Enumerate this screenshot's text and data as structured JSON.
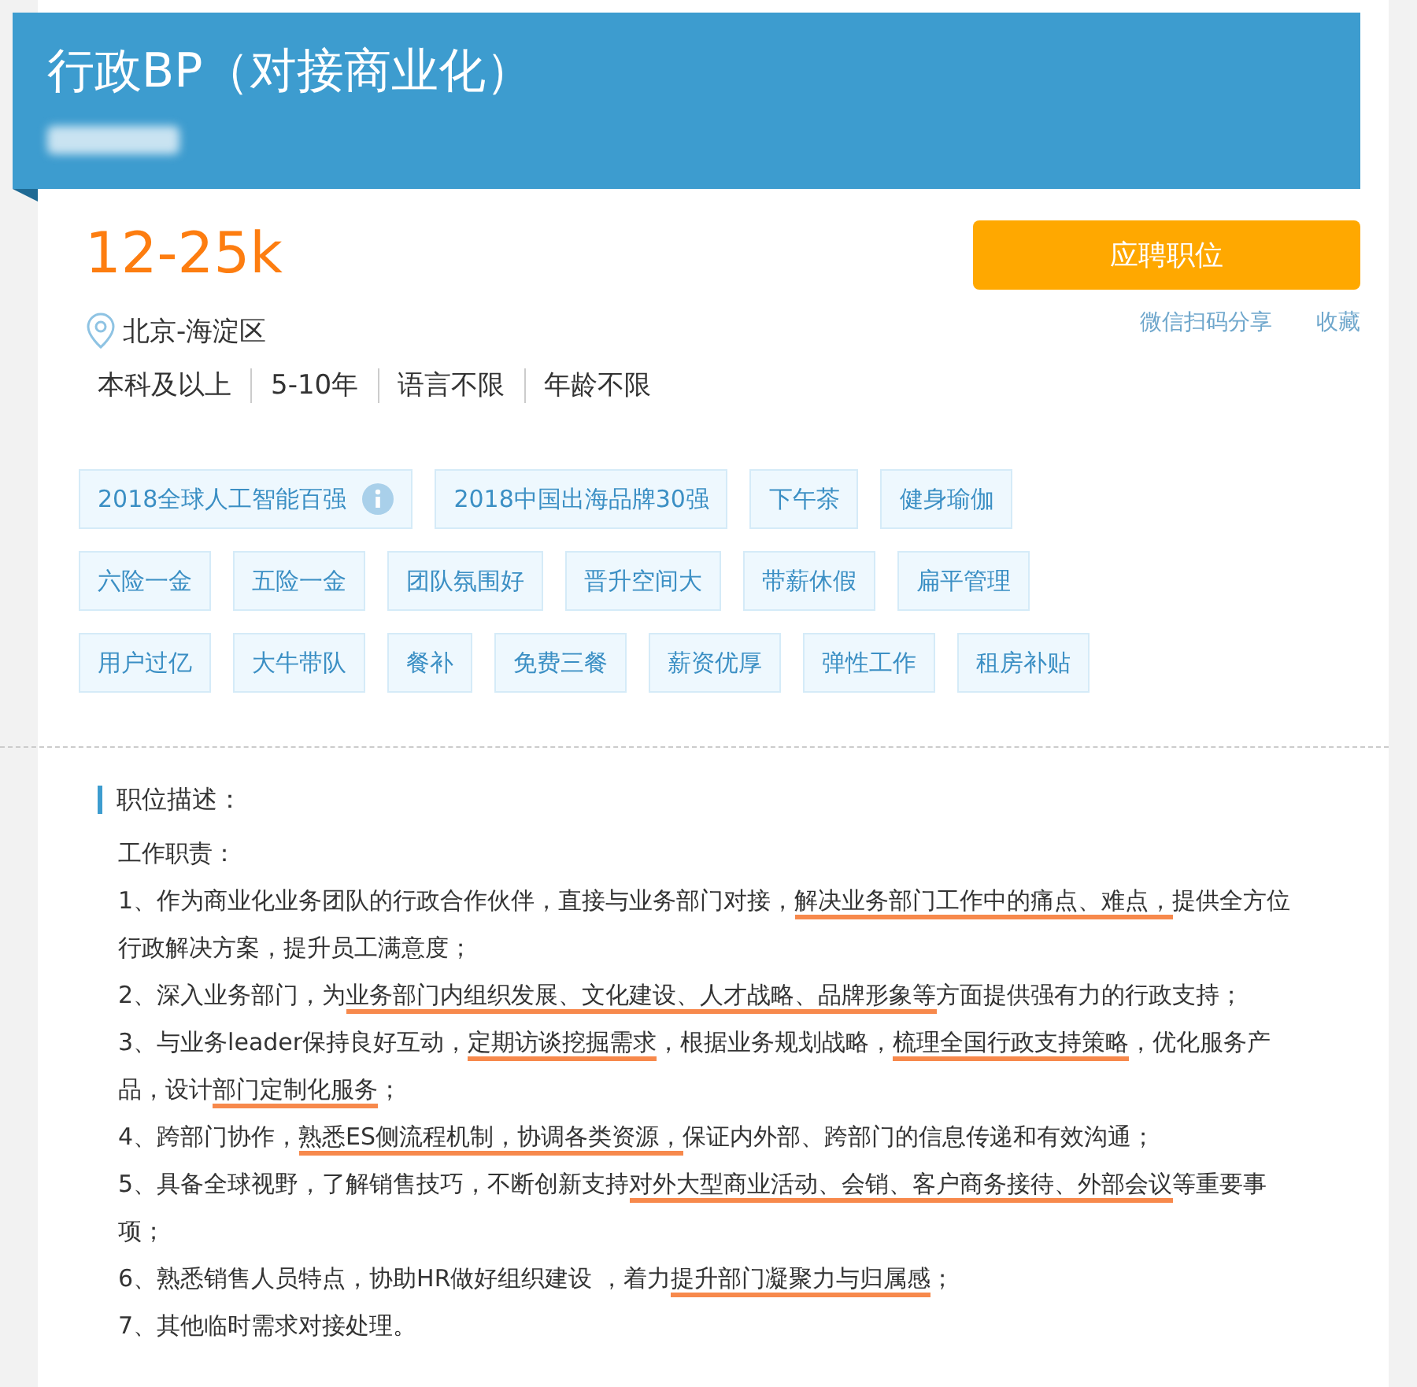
{
  "job": {
    "title": "行政BP（对接商业化）",
    "salary": "12-25k",
    "location": "北京-海淀区",
    "requirements": [
      "本科及以上",
      "5-10年",
      "语言不限",
      "年龄不限"
    ],
    "apply_button": "应聘职位",
    "links": [
      "微信扫码分享",
      "收藏"
    ]
  },
  "tags": [
    {
      "label": "2018全球人工智能百强",
      "info": true
    },
    {
      "label": "2018中国出海品牌30强",
      "info": false
    },
    {
      "label": "下午茶",
      "info": false
    },
    {
      "label": "健身瑜伽",
      "info": false
    },
    {
      "label": "六险一金",
      "info": false
    },
    {
      "label": "五险一金",
      "info": false
    },
    {
      "label": "团队氛围好",
      "info": false
    },
    {
      "label": "晋升空间大",
      "info": false
    },
    {
      "label": "带薪休假",
      "info": false
    },
    {
      "label": "扁平管理",
      "info": false
    },
    {
      "label": "用户过亿",
      "info": false
    },
    {
      "label": "大牛带队",
      "info": false
    },
    {
      "label": "餐补",
      "info": false
    },
    {
      "label": "免费三餐",
      "info": false
    },
    {
      "label": "薪资优厚",
      "info": false
    },
    {
      "label": "弹性工作",
      "info": false
    },
    {
      "label": "租房补贴",
      "info": false
    }
  ],
  "description": {
    "heading": "职位描述：",
    "paragraphs": [
      [
        {
          "text": "工作职责：",
          "underlined": false
        }
      ],
      [
        {
          "text": "1、作为商业化业务团队的行政合作伙伴，直接与业务部门对接，",
          "underlined": false
        },
        {
          "text": "解决业务部门工作中的痛点、难点，",
          "underlined": true
        },
        {
          "text": "提供全方位行政解决方案，提升员工满意度；",
          "underlined": false
        }
      ],
      [
        {
          "text": "2、深入业务部门，为",
          "underlined": false
        },
        {
          "text": "业务部门内组织发展、文化建设、人才战略、品牌形象等",
          "underlined": true
        },
        {
          "text": "方面提供强有力的行政支持；",
          "underlined": false
        }
      ],
      [
        {
          "text": "3、与业务leader保持良好互动，",
          "underlined": false
        },
        {
          "text": "定期访谈挖掘需求",
          "underlined": true
        },
        {
          "text": "，根据业务规划战略，",
          "underlined": false
        },
        {
          "text": "梳理全国行政支持策略",
          "underlined": true
        },
        {
          "text": "，优化服务产品，设计",
          "underlined": false
        },
        {
          "text": "部门定制化服务",
          "underlined": true
        },
        {
          "text": "；",
          "underlined": false
        }
      ],
      [
        {
          "text": "4、跨部门协作，",
          "underlined": false
        },
        {
          "text": "熟悉ES侧流程机制，协调各类资源，",
          "underlined": true
        },
        {
          "text": "保证内外部、跨部门的信息传递和有效沟通；",
          "underlined": false
        }
      ],
      [
        {
          "text": "5、具备全球视野，了解销售技巧，不断创新支持",
          "underlined": false
        },
        {
          "text": "对外大型商业活动、会销、客户商务接待、外部会议",
          "underlined": true
        },
        {
          "text": "等重要事项；",
          "underlined": false
        }
      ],
      [
        {
          "text": "6、熟悉销售人员特点，协助HR做好组织建设 ，着力",
          "underlined": false
        },
        {
          "text": "提升部门凝聚力与归属感",
          "underlined": true
        },
        {
          "text": "；",
          "underlined": false
        }
      ],
      [
        {
          "text": "7、其他临时需求对接处理。",
          "underlined": false
        }
      ]
    ]
  }
}
